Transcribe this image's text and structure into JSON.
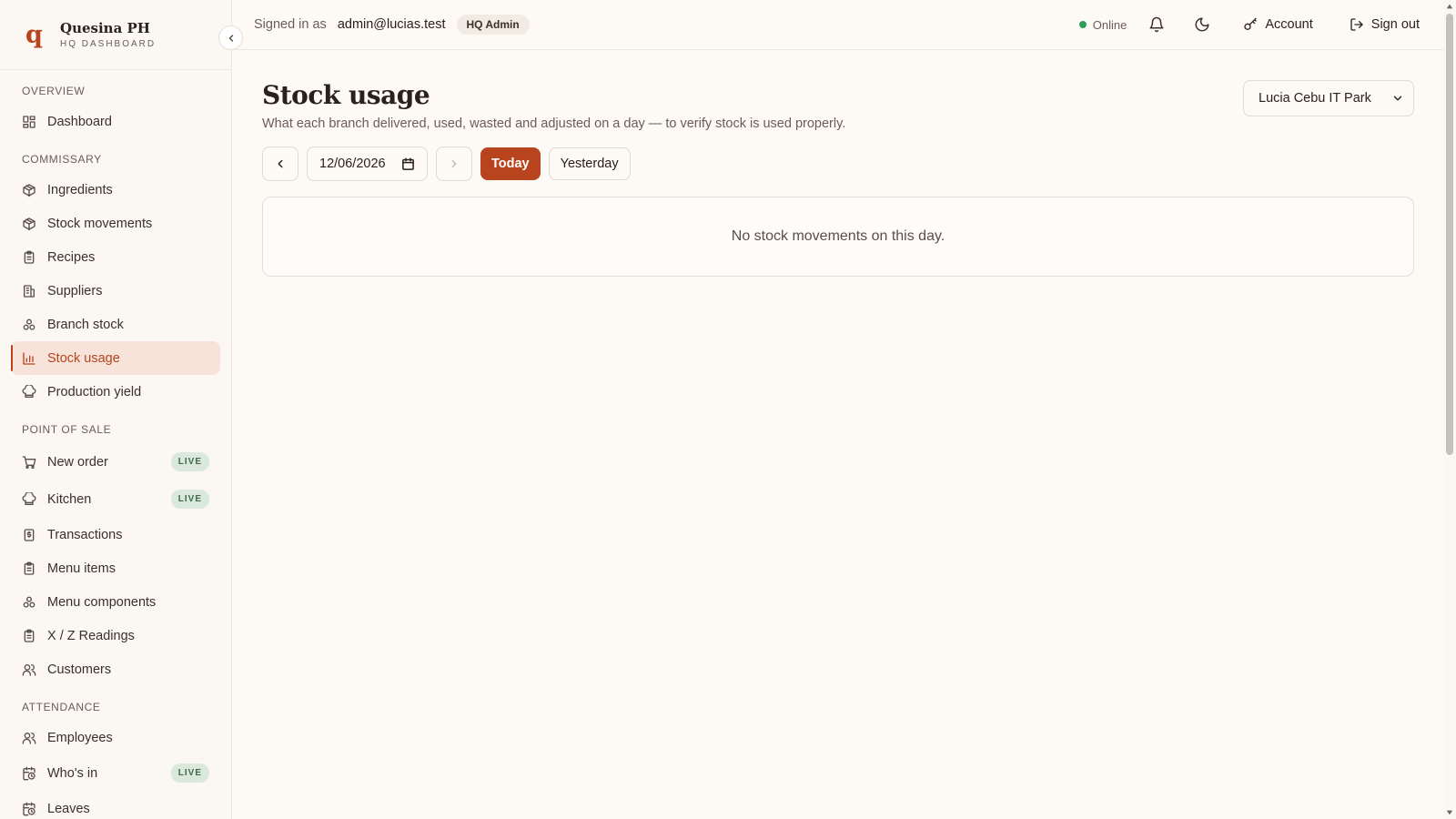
{
  "brand": {
    "logo": "q",
    "name": "Quesina PH",
    "subtitle": "HQ DASHBOARD"
  },
  "sidebar": {
    "sections": [
      {
        "title": "OVERVIEW",
        "items": [
          {
            "label": "Dashboard",
            "icon": "grid-icon"
          }
        ]
      },
      {
        "title": "COMMISSARY",
        "items": [
          {
            "label": "Ingredients",
            "icon": "package-icon"
          },
          {
            "label": "Stock movements",
            "icon": "package-icon"
          },
          {
            "label": "Recipes",
            "icon": "clipboard-icon"
          },
          {
            "label": "Suppliers",
            "icon": "building-icon"
          },
          {
            "label": "Branch stock",
            "icon": "boxes-icon"
          },
          {
            "label": "Stock usage",
            "icon": "bar-chart-icon",
            "active": true
          },
          {
            "label": "Production yield",
            "icon": "chef-hat-icon"
          }
        ]
      },
      {
        "title": "POINT OF SALE",
        "items": [
          {
            "label": "New order",
            "icon": "cart-icon",
            "badge": "LIVE"
          },
          {
            "label": "Kitchen",
            "icon": "chef-hat-icon",
            "badge": "LIVE"
          },
          {
            "label": "Transactions",
            "icon": "receipt-icon"
          },
          {
            "label": "Menu items",
            "icon": "clipboard-icon"
          },
          {
            "label": "Menu components",
            "icon": "boxes-icon"
          },
          {
            "label": "X / Z Readings",
            "icon": "clipboard-icon"
          },
          {
            "label": "Customers",
            "icon": "users-icon"
          }
        ]
      },
      {
        "title": "ATTENDANCE",
        "items": [
          {
            "label": "Employees",
            "icon": "users-icon"
          },
          {
            "label": "Who's in",
            "icon": "calendar-clock-icon",
            "badge": "LIVE"
          },
          {
            "label": "Leaves",
            "icon": "calendar-clock-icon"
          }
        ]
      }
    ]
  },
  "topbar": {
    "signed_in_label": "Signed in as",
    "email": "admin@lucias.test",
    "role": "HQ Admin",
    "status": "Online",
    "account_label": "Account",
    "signout_label": "Sign out"
  },
  "page": {
    "title": "Stock usage",
    "subtitle": "What each branch delivered, used, wasted and adjusted on a day — to verify stock is used properly.",
    "branch": "Lucia Cebu IT Park",
    "date": "12/06/2026",
    "today_label": "Today",
    "yesterday_label": "Yesterday",
    "empty_message": "No stock movements on this day."
  },
  "colors": {
    "accent": "#b8441d",
    "background": "#fdf9f5",
    "online": "#2f9e59",
    "live_badge": "#dbe8dc"
  }
}
